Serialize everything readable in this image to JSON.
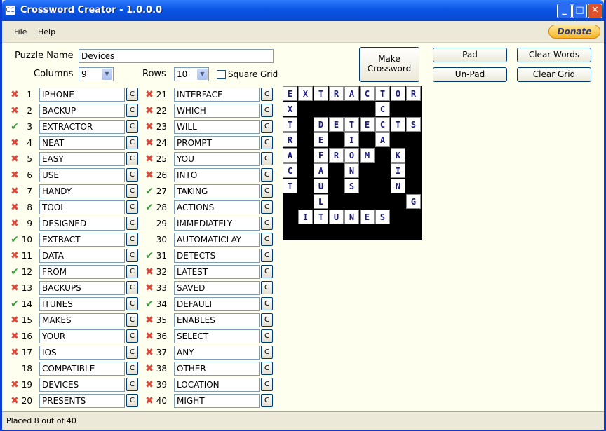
{
  "window": {
    "title": "Crossword Creator - 1.0.0.0",
    "icon": "app-icon"
  },
  "menu": {
    "file": "File",
    "help": "Help",
    "donate": "Donate"
  },
  "form": {
    "puzzle_name_label": "Puzzle Name",
    "puzzle_name_value": "Devices",
    "columns_label": "Columns",
    "columns_value": "9",
    "rows_label": "Rows",
    "rows_value": "10",
    "square_grid_label": "Square Grid",
    "square_grid_checked": false
  },
  "buttons": {
    "make_crossword": "Make Crossword",
    "pad": "Pad",
    "unpad": "Un-Pad",
    "clear_words": "Clear Words",
    "clear_grid": "Clear Grid",
    "c_label": "C"
  },
  "words_left": [
    {
      "num": "1",
      "word": "IPHONE",
      "status": "x"
    },
    {
      "num": "2",
      "word": "BACKUP",
      "status": "x"
    },
    {
      "num": "3",
      "word": "EXTRACTOR",
      "status": "check"
    },
    {
      "num": "4",
      "word": "NEAT",
      "status": "x"
    },
    {
      "num": "5",
      "word": "EASY",
      "status": "x"
    },
    {
      "num": "6",
      "word": "USE",
      "status": "x"
    },
    {
      "num": "7",
      "word": "HANDY",
      "status": "x"
    },
    {
      "num": "8",
      "word": "TOOL",
      "status": "x"
    },
    {
      "num": "9",
      "word": "DESIGNED",
      "status": "x"
    },
    {
      "num": "10",
      "word": "EXTRACT",
      "status": "check"
    },
    {
      "num": "11",
      "word": "DATA",
      "status": "x"
    },
    {
      "num": "12",
      "word": "FROM",
      "status": "check"
    },
    {
      "num": "13",
      "word": "BACKUPS",
      "status": "x"
    },
    {
      "num": "14",
      "word": "ITUNES",
      "status": "check"
    },
    {
      "num": "15",
      "word": "MAKES",
      "status": "x"
    },
    {
      "num": "16",
      "word": "YOUR",
      "status": "x"
    },
    {
      "num": "17",
      "word": "IOS",
      "status": "x"
    },
    {
      "num": "18",
      "word": "COMPATIBLE",
      "status": "none"
    },
    {
      "num": "19",
      "word": "DEVICES",
      "status": "x"
    },
    {
      "num": "20",
      "word": "PRESENTS",
      "status": "x"
    }
  ],
  "words_right": [
    {
      "num": "21",
      "word": "INTERFACE",
      "status": "x"
    },
    {
      "num": "22",
      "word": "WHICH",
      "status": "x"
    },
    {
      "num": "23",
      "word": "WILL",
      "status": "x"
    },
    {
      "num": "24",
      "word": "PROMPT",
      "status": "x"
    },
    {
      "num": "25",
      "word": "YOU",
      "status": "x"
    },
    {
      "num": "26",
      "word": "INTO",
      "status": "x"
    },
    {
      "num": "27",
      "word": "TAKING",
      "status": "check"
    },
    {
      "num": "28",
      "word": "ACTIONS",
      "status": "check"
    },
    {
      "num": "29",
      "word": "IMMEDIATELY",
      "status": "none"
    },
    {
      "num": "30",
      "word": "AUTOMATICLAY",
      "status": "none"
    },
    {
      "num": "31",
      "word": "DETECTS",
      "status": "check"
    },
    {
      "num": "32",
      "word": "LATEST",
      "status": "x"
    },
    {
      "num": "33",
      "word": "SAVED",
      "status": "x"
    },
    {
      "num": "34",
      "word": "DEFAULT",
      "status": "check"
    },
    {
      "num": "35",
      "word": "ENABLES",
      "status": "x"
    },
    {
      "num": "36",
      "word": "SELECT",
      "status": "x"
    },
    {
      "num": "37",
      "word": "ANY",
      "status": "x"
    },
    {
      "num": "38",
      "word": "OTHER",
      "status": "x"
    },
    {
      "num": "39",
      "word": "LOCATION",
      "status": "x"
    },
    {
      "num": "40",
      "word": "MIGHT",
      "status": "x"
    }
  ],
  "grid": [
    "EXTRACTOR",
    "X#####C##",
    "T#DETECTS",
    "R#E#I#A#",
    "A#FROM#K#",
    "C#A#N##I#",
    "T#U#S##N#",
    "##L#####G",
    "#ITUNES##",
    "#########"
  ],
  "status": {
    "text": "Placed 8 out of 40"
  }
}
